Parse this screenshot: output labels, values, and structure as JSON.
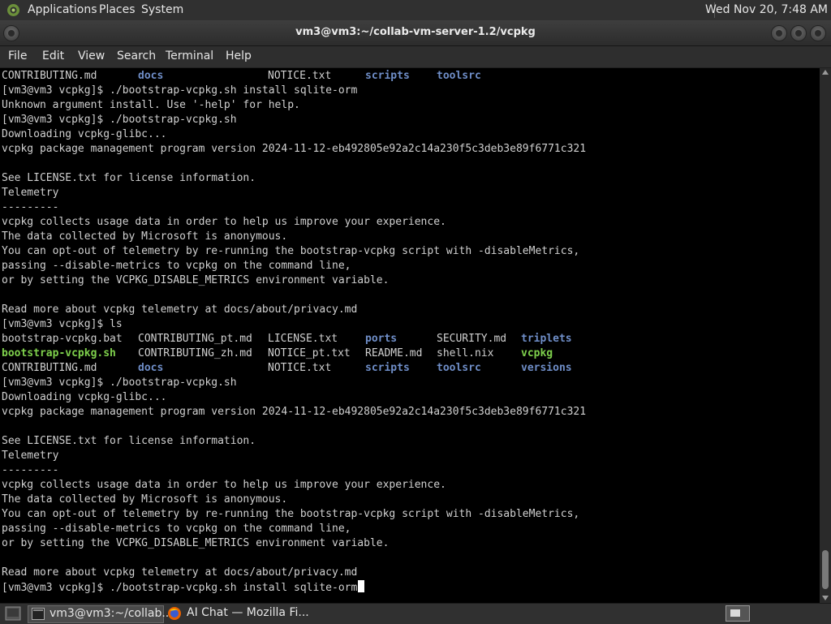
{
  "top_panel": {
    "menus": [
      "Applications",
      "Places",
      "System"
    ],
    "clock": "Wed Nov 20,  7:48 AM"
  },
  "window": {
    "title": "vm3@vm3:~/collab-vm-server-1.2/vcpkg",
    "menus": [
      "File",
      "Edit",
      "View",
      "Search",
      "Terminal",
      "Help"
    ]
  },
  "terminal": {
    "lines": [
      "CONTRIBUTING.md",
      "[vm3@vm3 vcpkg]$ ./bootstrap-vcpkg.sh install sqlite-orm",
      "Unknown argument install. Use '-help' for help.",
      "[vm3@vm3 vcpkg]$ ./bootstrap-vcpkg.sh",
      "Downloading vcpkg-glibc...",
      "vcpkg package management program version 2024-11-12-eb492805e92a2c14a230f5c3deb3e89f6771c321",
      "",
      "See LICENSE.txt for license information.",
      "Telemetry",
      "---------",
      "vcpkg collects usage data in order to help us improve your experience.",
      "The data collected by Microsoft is anonymous.",
      "You can opt-out of telemetry by re-running the bootstrap-vcpkg script with -disableMetrics,",
      "passing --disable-metrics to vcpkg on the command line,",
      "or by setting the VCPKG_DISABLE_METRICS environment variable.",
      "",
      "Read more about vcpkg telemetry at docs/about/privacy.md",
      "[vm3@vm3 vcpkg]$ ls",
      "",
      "",
      "",
      "[vm3@vm3 vcpkg]$ ./bootstrap-vcpkg.sh",
      "Downloading vcpkg-glibc...",
      "vcpkg package management program version 2024-11-12-eb492805e92a2c14a230f5c3deb3e89f6771c321",
      "",
      "See LICENSE.txt for license information.",
      "Telemetry",
      "---------",
      "vcpkg collects usage data in order to help us improve your experience.",
      "The data collected by Microsoft is anonymous.",
      "You can opt-out of telemetry by re-running the bootstrap-vcpkg script with -disableMetrics,",
      "passing --disable-metrics to vcpkg on the command line,",
      "or by setting the VCPKG_DISABLE_METRICS environment variable.",
      "",
      "Read more about vcpkg telemetry at docs/about/privacy.md",
      "[vm3@vm3 vcpkg]$ ./bootstrap-vcpkg.sh install sqlite-orm"
    ],
    "first_row_extra": [
      {
        "text": "docs",
        "kind": "dir"
      },
      {
        "text": "NOTICE.txt",
        "kind": "file"
      },
      {
        "text": "scripts",
        "kind": "dir"
      },
      {
        "text": "toolsrc",
        "kind": "dir"
      }
    ],
    "ls_rows": [
      [
        {
          "text": "bootstrap-vcpkg.bat",
          "kind": "file"
        },
        {
          "text": "CONTRIBUTING_pt.md",
          "kind": "file"
        },
        {
          "text": "LICENSE.txt",
          "kind": "file"
        },
        {
          "text": "ports",
          "kind": "dir"
        },
        {
          "text": "SECURITY.md",
          "kind": "file"
        },
        {
          "text": "triplets",
          "kind": "dir"
        }
      ],
      [
        {
          "text": "bootstrap-vcpkg.sh",
          "kind": "exe"
        },
        {
          "text": "CONTRIBUTING_zh.md",
          "kind": "file"
        },
        {
          "text": "NOTICE_pt.txt",
          "kind": "file"
        },
        {
          "text": "README.md",
          "kind": "file"
        },
        {
          "text": "shell.nix",
          "kind": "file"
        },
        {
          "text": "vcpkg",
          "kind": "exe"
        }
      ],
      [
        {
          "text": "CONTRIBUTING.md",
          "kind": "file"
        },
        {
          "text": "docs",
          "kind": "dir"
        },
        {
          "text": "NOTICE.txt",
          "kind": "file"
        },
        {
          "text": "scripts",
          "kind": "dir"
        },
        {
          "text": "toolsrc",
          "kind": "dir"
        },
        {
          "text": "versions",
          "kind": "dir"
        }
      ]
    ],
    "colors": {
      "dir": "#6f8ec8",
      "exe": "#7ed04c",
      "text": "#d0d0d0",
      "bg": "#000000"
    }
  },
  "taskbar": {
    "items": [
      {
        "label": "vm3@vm3:~/collab...",
        "icon": "terminal-icon"
      },
      {
        "label": "AI Chat — Mozilla Fi...",
        "icon": "firefox-icon"
      }
    ]
  }
}
